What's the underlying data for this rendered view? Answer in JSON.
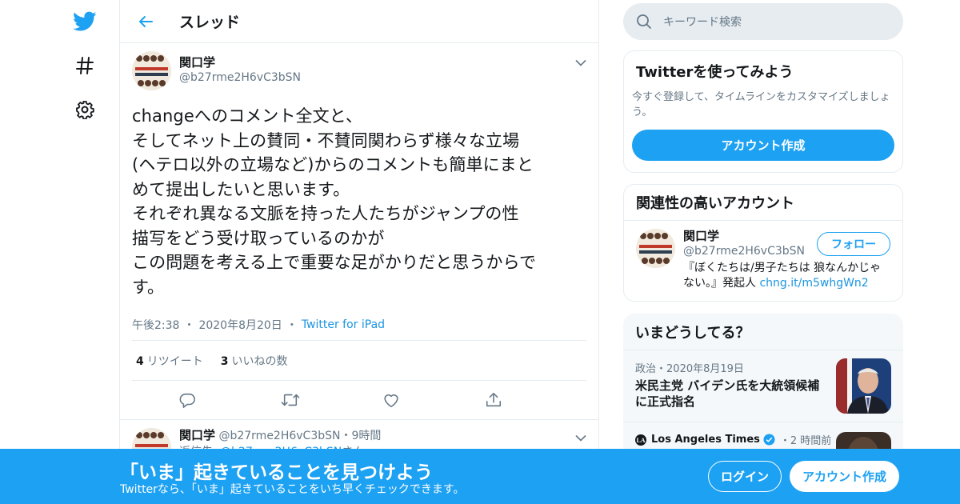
{
  "topbar": {
    "title": "スレッド"
  },
  "tweet": {
    "display_name": "関口学",
    "handle": "@b27rme2H6vC3bSN",
    "text": "changeへのコメント全文と、\nそしてネット上の賛同・不賛同関わらず様々な立場\n(ヘテロ以外の立場など)からのコメントも簡単にまと\nめて提出したいと思います。\nそれぞれ異なる文脈を持った人たちがジャンプの性\n描写をどう受け取っているのかが\nこの問題を考える上で重要な足がかりだと思うからで\nす。",
    "time": "午後2:38",
    "date": "2020年8月20日",
    "dot": "・",
    "source": "Twitter for iPad",
    "retweet_count": "4",
    "retweet_label": "リツイート",
    "like_count": "3",
    "like_label": "いいねの数"
  },
  "reply": {
    "display_name": "関口学",
    "handle": "@b27rme2H6vC3bSN",
    "dot": "・",
    "time": "9時間",
    "reply_prefix": "返信先: ",
    "reply_handle": "@b27rme2H6vC3bSN",
    "reply_suffix": "さん"
  },
  "search": {
    "placeholder": "キーワード検索"
  },
  "signup_card": {
    "title": "Twitterを使ってみよう",
    "desc": "今すぐ登録して、タイムラインをカスタマイズしましょう。",
    "button": "アカウント作成"
  },
  "related": {
    "title": "関連性の高いアカウント",
    "display_name": "関口学",
    "handle": "@b27rme2H6vC3bSN",
    "follow": "フォロー",
    "bio": "『ぼくたちは/男子たちは 狼なんかじゃない。』発起人 ",
    "bio_link": "chng.it/m5whgWn2"
  },
  "trends": {
    "title": "いまどうしてる？",
    "items": [
      {
        "category": "政治",
        "dot": "・",
        "date": "2020年8月19日",
        "title": "米民主党 バイデン氏を大統領候補に正式指名"
      },
      {
        "source": "Los Angeles Times",
        "dot": "・",
        "time": "2 時間前"
      }
    ]
  },
  "bottombar": {
    "title": "「いま」起きていることを見つけよう",
    "subtitle": "Twitterなら、「いま」起きていることをいち早くチェックできます。",
    "login": "ログイン",
    "signup": "アカウント作成"
  },
  "colors": {
    "accent": "#1da1f2",
    "link": "#1b95e0",
    "secondary_text": "#657786",
    "border": "#e6ecf0"
  },
  "icons": [
    "twitter-bird-icon",
    "hashtag-icon",
    "settings-gear-icon",
    "back-arrow-icon",
    "chevron-down-icon",
    "reply-icon",
    "retweet-icon",
    "like-icon",
    "share-icon",
    "search-icon",
    "verified-badge-icon"
  ]
}
